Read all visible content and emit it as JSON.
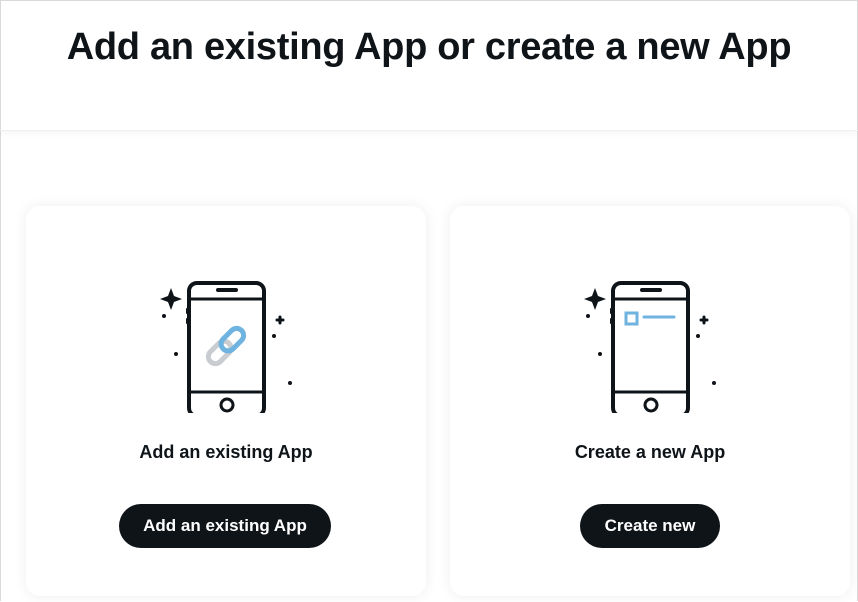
{
  "page": {
    "title": "Add an existing App or create a new App"
  },
  "options": [
    {
      "heading": "Add an existing App",
      "button_label": "Add an existing App",
      "icon": "phone-link-icon"
    },
    {
      "heading": "Create a new App",
      "button_label": "Create new",
      "icon": "phone-new-app-icon"
    }
  ],
  "colors": {
    "text": "#0f1419",
    "button_bg": "#0f1419",
    "button_text": "#ffffff",
    "accent_blue": "#6fb3e0",
    "accent_grey": "#c9ccd1"
  }
}
